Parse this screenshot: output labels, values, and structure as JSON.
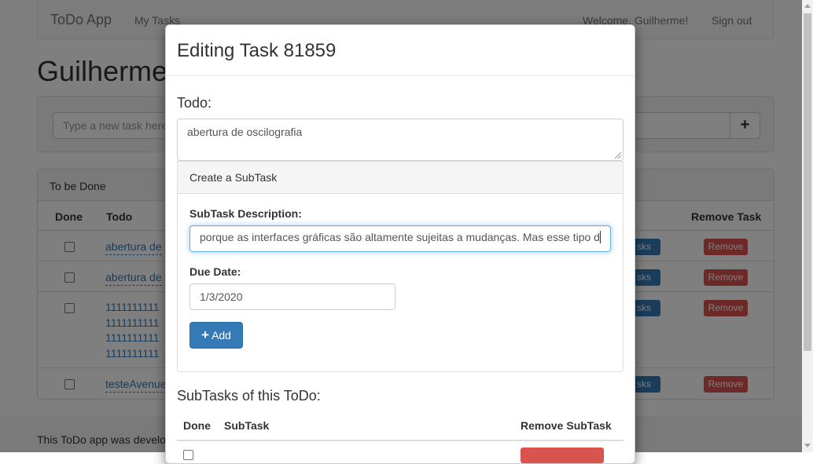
{
  "navbar": {
    "brand": "ToDo App",
    "my_tasks": "My Tasks",
    "welcome": "Welcome, Guilherme!",
    "sign_out": "Sign out"
  },
  "page_title": "Guilherme",
  "new_task": {
    "placeholder": "Type a new task here",
    "add_icon": "plus-icon"
  },
  "tasks_panel": {
    "heading": "To be Done",
    "columns": {
      "done": "Done",
      "todo": "Todo",
      "remove": "Remove Task"
    },
    "rows": [
      {
        "text": "abertura de",
        "subtasks_label": "sks",
        "remove_label": "Remove"
      },
      {
        "text": "abertura de",
        "subtasks_label": "sks",
        "remove_label": "Remove"
      },
      {
        "lines": [
          "1111111111",
          "1111111111",
          "1111111111",
          "1111111111"
        ],
        "subtasks_label": "sks",
        "remove_label": "Remove"
      },
      {
        "text": "testeAvenue",
        "subtasks_label": "sks",
        "remove_label": "Remove"
      }
    ]
  },
  "footer": {
    "text": "This ToDo app was develo"
  },
  "modal": {
    "title": "Editing Task 81859",
    "todo_label": "Todo:",
    "todo_value": "abertura de oscilografia",
    "create_subtask_heading": "Create a SubTask",
    "subtask_description_label": "SubTask Description:",
    "subtask_description_value": "porque as interfaces gráficas são altamente sujeitas a mudanças. Mas esse tipo d",
    "due_date_label": "Due Date:",
    "due_date_value": "1/3/2020",
    "add_button_label": "Add",
    "subtasks_title": "SubTasks of this ToDo:",
    "subtasks_columns": {
      "done": "Done",
      "subtask": "SubTask",
      "remove": "Remove SubTask"
    }
  }
}
